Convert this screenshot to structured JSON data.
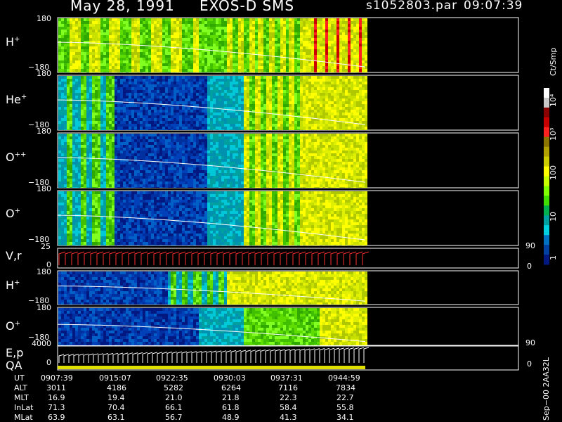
{
  "header": {
    "date": "May 28, 1991",
    "instrument": "EXOS-D SMS",
    "filename": "s1052803.par",
    "time": "09:07:39"
  },
  "panels": [
    {
      "label": "H",
      "charge": "+",
      "ymax": "180",
      "ymin": "−180"
    },
    {
      "label": "He",
      "charge": "+",
      "ymax": "180",
      "ymin": "−180"
    },
    {
      "label": "O",
      "charge": "++",
      "ymax": "180",
      "ymin": "−180"
    },
    {
      "label": "O",
      "charge": "+",
      "ymax": "180",
      "ymin": "−180"
    },
    {
      "label": "V,r",
      "charge": "",
      "ymax": "25",
      "ymin": "0",
      "right_max": "90",
      "right_min": "0"
    },
    {
      "label": "H",
      "charge": "+",
      "ymax": "180",
      "ymin": "−180"
    },
    {
      "label": "O",
      "charge": "+",
      "ymax": "180",
      "ymin": "−180"
    },
    {
      "label": "E,p",
      "label2": "QA",
      "charge": "",
      "ymax": "4000",
      "ymin": "0",
      "right_max": "90",
      "right_min": "0"
    }
  ],
  "colorbar": {
    "unit": "Ct/Smp",
    "ticks": [
      "10⁴",
      "10³",
      "100",
      "10",
      "1"
    ],
    "colors": [
      "#ffffff",
      "#c8c8c8",
      "#8b0000",
      "#c80000",
      "#ff2020",
      "#8b7500",
      "#b0a000",
      "#cccc00",
      "#ffff00",
      "#c8ff00",
      "#80ff00",
      "#40dd00",
      "#00b050",
      "#00a0a0",
      "#00d0e0",
      "#0070c0",
      "#0040a0",
      "#001880"
    ]
  },
  "ephemeris": {
    "row_labels": [
      "UT",
      "ALT",
      "MLT",
      "InLat",
      "MLat"
    ],
    "columns": [
      [
        "0907:39",
        "3011",
        "16.9",
        "71.3",
        "63.9"
      ],
      [
        "0915:07",
        "4186",
        "19.4",
        "70.4",
        "63.1"
      ],
      [
        "0922:35",
        "5282",
        "21.0",
        "66.1",
        "56.7"
      ],
      [
        "0930:03",
        "6264",
        "21.8",
        "61.8",
        "48.9"
      ],
      [
        "0937:31",
        "7116",
        "22.3",
        "58.4",
        "41.3"
      ],
      [
        "0944:59",
        "7834",
        "22.7",
        "55.8",
        "34.1"
      ]
    ]
  },
  "footer_note": "Sep−00 2AA32L",
  "chart_data": {
    "type": "heatmap",
    "title": "May 28, 1991   EXOS-D SMS",
    "xlabel": "UT",
    "x_ticks": [
      "0907:39",
      "0915:07",
      "0922:35",
      "0930:03",
      "0937:31",
      "0944:59"
    ],
    "panels": [
      "H+",
      "He+",
      "O++",
      "O+",
      "V,r",
      "H+",
      "O+",
      "E,p"
    ],
    "pitch_angle_range": [
      -180,
      180
    ],
    "color_scale": {
      "type": "log",
      "unit": "Ct/Smp",
      "range": [
        1,
        10000
      ]
    }
  }
}
